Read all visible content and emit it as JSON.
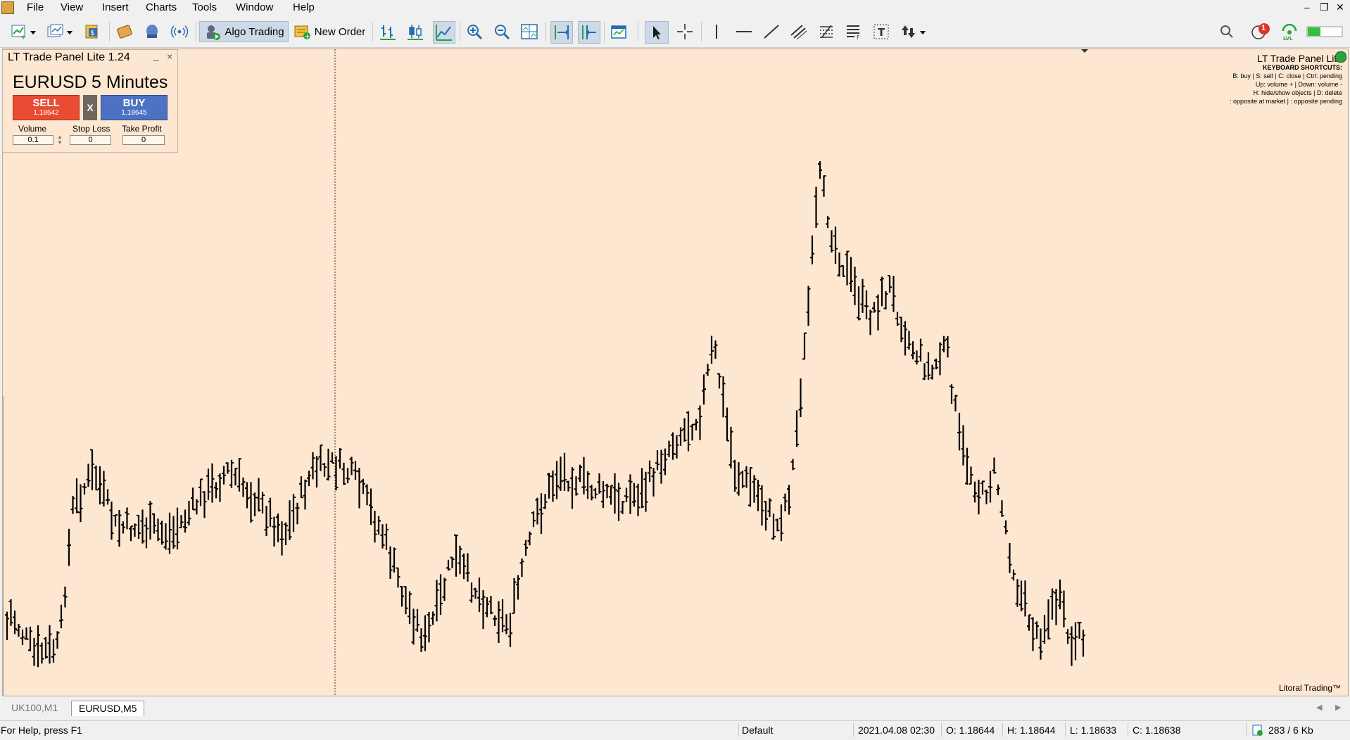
{
  "menu": {
    "items": [
      "File",
      "View",
      "Insert",
      "Charts",
      "Tools",
      "Window",
      "Help"
    ],
    "window_controls": [
      "–",
      "❐",
      "✕"
    ]
  },
  "toolbar": {
    "algo_trading_label": "Algo Trading",
    "new_order_label": "New Order",
    "notification_count": "1",
    "colors": {
      "accent_green": "#2aa33a",
      "pressed": "#cdd9e6"
    }
  },
  "trade_panel": {
    "title": "LT Trade Panel Lite 1.24",
    "minimize": "_",
    "close": "×",
    "symbol": "EURUSD",
    "timeframe": "5 Minutes",
    "sell_label": "SELL",
    "sell_price": "1.18642",
    "close_all_label": "X",
    "buy_label": "BUY",
    "buy_price": "1.18645",
    "volume_label": "Volume",
    "volume_value": "0.1",
    "stop_loss_label": "Stop Loss",
    "stop_loss_value": "0",
    "take_profit_label": "Take Profit",
    "take_profit_value": "0",
    "colors": {
      "sell": "#e94b33",
      "buy": "#4e72c3",
      "close": "#6f665d"
    }
  },
  "chart_overlay": {
    "title": "LT Trade Panel Lite",
    "shortcuts_header": "KEYBOARD SHORTCUTS:",
    "shortcut_lines": [
      "B: buy  |  S: sell  |  C: close  | Ctrl: pending",
      "Up: volume +  |  Down: volume -",
      "H: hide/show objects  |  D: delete",
      ": opposite at market  |  : opposite pending"
    ],
    "brand": "Litoral Trading™",
    "background": "#fee7d0"
  },
  "tabs": [
    {
      "label": "UK100,M1",
      "active": false
    },
    {
      "label": "EURUSD,M5",
      "active": true
    }
  ],
  "status": {
    "help": "For Help, press F1",
    "profile": "Default",
    "datetime": "2021.04.08 02:30",
    "open": "O: 1.18644",
    "high": "H: 1.18644",
    "low": "L: 1.18633",
    "close": "C: 1.18638",
    "traffic": "283 / 6 Kb"
  }
}
